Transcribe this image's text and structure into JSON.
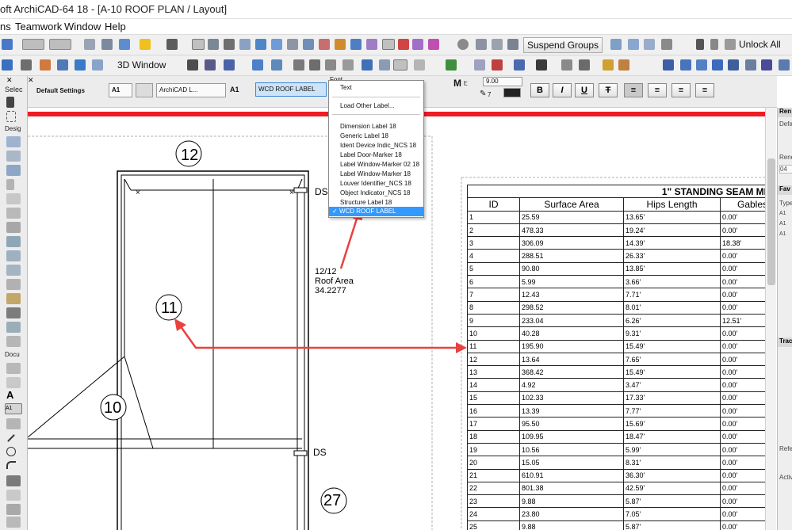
{
  "window": {
    "title": "oft ArchiCAD-64 18 - [A-10 ROOF PLAN / Layout]"
  },
  "menu": {
    "items": [
      "ns",
      "Teamwork",
      "Window",
      "Help"
    ]
  },
  "toolbar1": {
    "suspend_groups": "Suspend Groups",
    "unlock_all": "Unlock All"
  },
  "toolbar2": {
    "window_3d": "3D Window"
  },
  "infobox": {
    "section_label": "Default Settings",
    "label_icon": "A1",
    "archicad_label": "ArchiCAD L...",
    "label_tool_icon": "A1",
    "label_selector": "WCD ROOF LABEL",
    "font_header": "Font",
    "font_size_label": "t:",
    "font_size": "9.00",
    "pen_number": "7",
    "bold": "B",
    "italic": "I",
    "underline": "U",
    "strike": "T"
  },
  "dropdown": {
    "top_item": "Text",
    "load_other": "Load Other Label...",
    "items": [
      "Dimension Label 18",
      "Generic Label 18",
      "Ident Device Indic_NCS 18",
      "Label Door-Marker 18",
      "Label Window-Marker 02 18",
      "Label Window-Marker 18",
      "Louver Identifier_NCS 18",
      "Object Indicator_NCS 18",
      "Structure Label 18"
    ],
    "selected": "WCD ROOF LABEL"
  },
  "toolbox": {
    "sections": [
      "Selec",
      "Desig",
      "Docu"
    ]
  },
  "right_panel": {
    "labels": [
      "Ren",
      "Defa",
      "Rene",
      "04",
      "Fav",
      "Type",
      "A1",
      "A1",
      "A1",
      "Trac",
      "Refe",
      "Activ"
    ]
  },
  "drawing": {
    "roof_labels": [
      "12",
      "11",
      "10",
      "27"
    ],
    "ds_labels": [
      "DS",
      "DS"
    ],
    "roof_area_lines": [
      "12/12",
      "Roof Area",
      "34.2277"
    ]
  },
  "schedule": {
    "title": "1\" STANDING SEAM MET",
    "columns": [
      "ID",
      "Surface Area",
      "Hips Length",
      "Gables"
    ],
    "rows": [
      [
        "1",
        "25.59",
        "13.65'",
        "0.00'"
      ],
      [
        "2",
        "478.33",
        "19.24'",
        "0.00'"
      ],
      [
        "3",
        "306.09",
        "14.39'",
        "18.38'"
      ],
      [
        "4",
        "288.51",
        "26.33'",
        "0.00'"
      ],
      [
        "5",
        "90.80",
        "13.85'",
        "0.00'"
      ],
      [
        "6",
        "5.99",
        "3.66'",
        "0.00'"
      ],
      [
        "7",
        "12.43",
        "7.71'",
        "0.00'"
      ],
      [
        "8",
        "298.52",
        "8.01'",
        "0.00'"
      ],
      [
        "9",
        "233.04",
        "6.26'",
        "12.51'"
      ],
      [
        "10",
        "40.28",
        "9.31'",
        "0.00'"
      ],
      [
        "11",
        "195.90",
        "15.49'",
        "0.00'"
      ],
      [
        "12",
        "13.64",
        "7.65'",
        "0.00'"
      ],
      [
        "13",
        "368.42",
        "15.49'",
        "0.00'"
      ],
      [
        "14",
        "4.92",
        "3.47'",
        "0.00'"
      ],
      [
        "15",
        "102.33",
        "17.33'",
        "0.00'"
      ],
      [
        "16",
        "13.39",
        "7.77'",
        "0.00'"
      ],
      [
        "17",
        "95.50",
        "15.69'",
        "0.00'"
      ],
      [
        "18",
        "109.95",
        "18.47'",
        "0.00'"
      ],
      [
        "19",
        "10.56",
        "5.99'",
        "0.00'"
      ],
      [
        "20",
        "15.05",
        "8.31'",
        "0.00'"
      ],
      [
        "21",
        "610.91",
        "36.30'",
        "0.00'"
      ],
      [
        "22",
        "801.38",
        "42.59'",
        "0.00'"
      ],
      [
        "23",
        "9.88",
        "5.87'",
        "0.00'"
      ],
      [
        "24",
        "23.80",
        "7.05'",
        "0.00'"
      ],
      [
        "25",
        "9.88",
        "5.87'",
        "0.00'"
      ]
    ]
  },
  "colors": {
    "annotation_arrow": "#e8413f",
    "selection_blue": "#3399ff",
    "red_band": "#ee1c24"
  }
}
